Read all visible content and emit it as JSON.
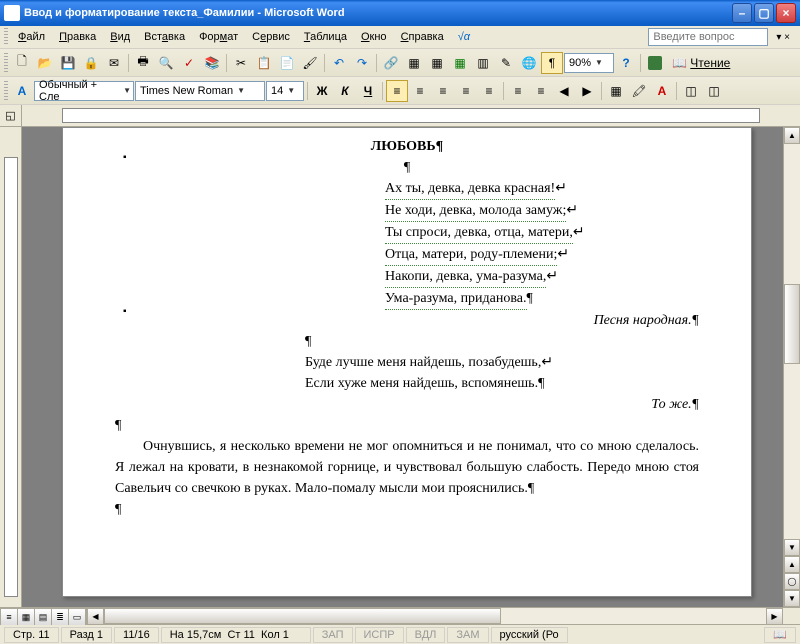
{
  "title": "Ввод и форматирование текста_Фамилии - Microsoft Word",
  "menu": {
    "file": "Файл",
    "edit": "Правка",
    "view": "Вид",
    "insert": "Вставка",
    "format": "Формат",
    "tools": "Сервис",
    "table": "Таблица",
    "window": "Окно",
    "help": "Справка",
    "math": "√α",
    "question": "Введите вопрос"
  },
  "standard": {
    "zoom": "90%",
    "read": "Чтение"
  },
  "formatting": {
    "style": "Обычный + Сле",
    "font": "Times New Roman",
    "size": "14",
    "bold": "Ж",
    "italic": "К",
    "underline": "Ч"
  },
  "doc": {
    "title": "ЛЮБОВЬ",
    "poem1": [
      "Ах ты, девка, девка красная!",
      "Не ходи, девка, молода замуж;",
      "Ты спроси, девка, отца, матери,",
      "Отца, матери, роду-племени;",
      "Накопи, девка, ума-разума,",
      "Ума-разума, приданова."
    ],
    "attrib1": "Песня народная.",
    "poem2": [
      "Буде лучше меня найдешь, позабудешь,",
      "Если хуже меня найдешь, вспомянешь."
    ],
    "attrib2": "То же.",
    "para": "Очнувшись, я несколько времени не мог опомниться и не понимал, что со мною сделалось. Я лежал на кровати, в незнакомой горнице, и чувствовал большую слабость. Передо мною стоя Савельич со свечкою в руках. Мало-помалу мысли мои прояснились."
  },
  "status": {
    "page": "Стр. 11",
    "section": "Разд 1",
    "pages": "11/16",
    "at": "На 15,7см",
    "line": "Ст 11",
    "col": "Кол 1",
    "rec": "ЗАП",
    "trk": "ИСПР",
    "ext": "ВДЛ",
    "ovr": "ЗАМ",
    "lang": "русский (Ро"
  },
  "icons": {
    "new": "🗋",
    "open": "📂",
    "save": "💾",
    "perm": "🔒",
    "mail": "✉",
    "print": "🖶",
    "preview": "🔍",
    "spell": "✓",
    "research": "📚",
    "cut": "✂",
    "copy": "📋",
    "paste": "📄",
    "fmt": "🖌",
    "undo": "↶",
    "redo": "↷",
    "link": "🔗",
    "tables": "▦",
    "table": "▦",
    "excel": "▦",
    "cols": "▥",
    "draw": "✎",
    "map": "🌐",
    "pilcrow": "¶",
    "help": "?",
    "shield": "🛡",
    "read": "📖",
    "alignL": "≡",
    "alignC": "≡",
    "alignR": "≡",
    "alignJ": "≡",
    "linesp": "≡",
    "numlist": "≡",
    "bullist": "≡",
    "outdent": "◀",
    "indent": "▶",
    "borders": "▦",
    "highlight": "🖍",
    "fontcolor": "A",
    "styles": "A"
  }
}
